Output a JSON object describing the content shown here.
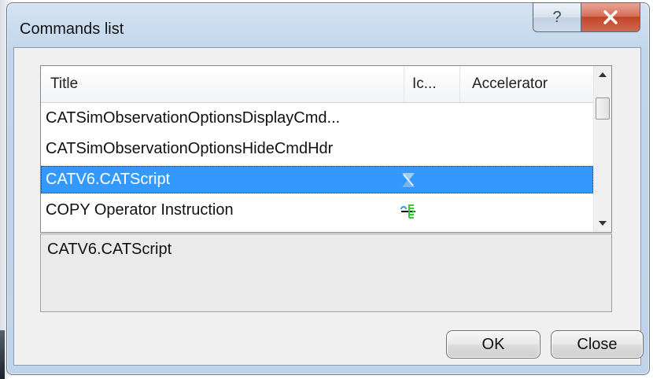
{
  "window": {
    "title": "Commands list",
    "help_label": "?",
    "close_label": "X"
  },
  "list": {
    "columns": [
      "Title",
      "Ic...",
      "Accelerator"
    ],
    "rows": [
      {
        "title": "CATSimObservationOptionsDisplayCmd...",
        "icon": "",
        "accelerator": "",
        "selected": false
      },
      {
        "title": "CATSimObservationOptionsHideCmdHdr",
        "icon": "",
        "accelerator": "",
        "selected": false
      },
      {
        "title": "CATV6.CATScript",
        "icon": "catscript-icon",
        "accelerator": "",
        "selected": true
      },
      {
        "title": "COPY Operator Instruction",
        "icon": "copy-instruction-icon",
        "accelerator": "",
        "selected": false
      }
    ]
  },
  "description": {
    "text": "CATV6.CATScript"
  },
  "buttons": {
    "ok_label": "OK",
    "close_label": "Close"
  },
  "colors": {
    "selection": "#3399ff",
    "close_button": "#c2452b"
  }
}
